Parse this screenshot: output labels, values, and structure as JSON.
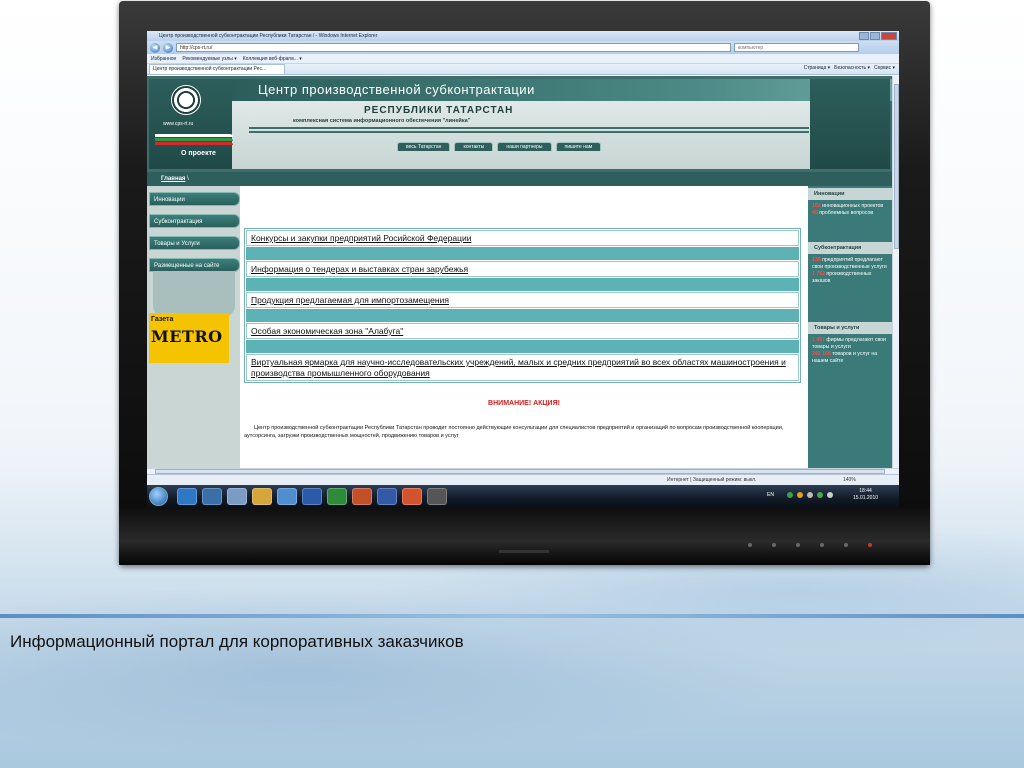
{
  "slide": {
    "caption": "Информационный портал для корпоративных заказчиков"
  },
  "browser": {
    "window_title": "Центр производственной субконтрактации Республики Татарстан / - Windows Internet Explorer",
    "address": "http://cps-rt.ru/",
    "search_placeholder": "компьютер",
    "favorites_label": "Избранное",
    "fav_items": [
      "Рекомендуемые узлы ▾",
      "Коллекция веб-фрагм... ▾"
    ],
    "tab_title": "Центр производственной субконтрактации Рес...",
    "command_bar": [
      "Страница ▾",
      "Безопасность ▾",
      "Сервис ▾"
    ]
  },
  "site": {
    "url": "www.cps-rt.ru",
    "title": "Центр производственной субконтрактации",
    "subtitle": "РЕСПУБЛИКИ ТАТАРСТАН",
    "description": "комплексная система информационного обеспечения \"линейка\"",
    "about_label": "О проекте",
    "top_nav": [
      "весь Татарстан",
      "контакты",
      "наши партнеры",
      "пишите нам"
    ],
    "breadcrumb_home": "Главная",
    "breadcrumb_sep": "\\",
    "left_menu": [
      "Инновации",
      "Субконтрактация",
      "Товары и Услуги",
      "Размещенные на сайте"
    ],
    "metro": {
      "top": "Газета",
      "brand": "METRO"
    },
    "links": [
      "Конкурсы и закупки предприятий Росийской Федерации",
      "Информация о тендерах и выставках стран зарубежья",
      "Продукция предлагаемая для импортозамещения",
      "Особая экономическая зона \"Алабуга\"",
      "Виртуальная ярмарка для научно-исследовательских учреждений, малых и средних предприятий во всех областях машиностроения и производства промышленного оборудования"
    ],
    "attention": "ВНИМАНИЕ! АКЦИЯ!",
    "paragraph": "Центр производственной субконтрактации Республики Татарстан проводит постоянно действующие консультации для специалистов предприятий и организаций по вопросам производственной кооперации, аутсорсинга, загрузки производственных мощностей, продвижению товаров и услуг",
    "right_sections": [
      {
        "head": "Инновации",
        "n1": "162",
        "t1": " инновационных проектов",
        "n2": "45",
        "t2": " проблемных вопросов"
      },
      {
        "head": "Субконтрактация",
        "n1": "138",
        "t1": " предприятий предлагают свои производственные услуги",
        "n2": "1 752",
        "t2": " производственных заказов"
      },
      {
        "head": "Товары и услуги",
        "n1": "1 057",
        "t1": " фирмы предлагают свои товары и услуги",
        "n2": "243 168",
        "t2": " товаров и услуг на нашем сайте"
      }
    ]
  },
  "statusbar": {
    "zone": "Интернет | Защищенный режим: выкл.",
    "zoom": "140%"
  },
  "taskbar": {
    "lang": "EN",
    "time": "18:44",
    "date": "15.01.2010"
  },
  "colors": {
    "teal_dark": "#2f5f5c",
    "teal_band": "#5cb2b4",
    "attention_red": "#d41c1c",
    "metro_yellow": "#f5c400"
  }
}
